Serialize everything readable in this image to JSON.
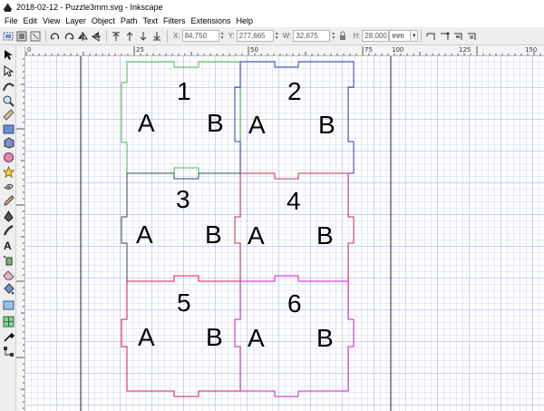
{
  "window": {
    "title": "2018-02-12 - Puzzle3mm.svg - Inkscape"
  },
  "menu": [
    {
      "label": "File",
      "icon": ""
    },
    {
      "label": "Edit",
      "icon": ""
    },
    {
      "label": "View",
      "icon": ""
    },
    {
      "label": "Layer",
      "icon": ""
    },
    {
      "label": "Object",
      "icon": ""
    },
    {
      "label": "Path",
      "icon": ""
    },
    {
      "label": "Text",
      "icon": ""
    },
    {
      "label": "Filters",
      "icon": ""
    },
    {
      "label": "Extensions",
      "icon": ""
    },
    {
      "label": "Help",
      "icon": ""
    }
  ],
  "toolbar": {
    "x_label": "X:",
    "x_value": "84,750",
    "y_label": "Y:",
    "y_value": "277,665",
    "w_label": "W:",
    "w_value": "32,675",
    "h_label": "H:",
    "h_value": "28,000",
    "unit": "mm"
  },
  "ruler": {
    "h_labels": [
      "0",
      "25",
      "50",
      "75",
      "100",
      "125",
      "150"
    ],
    "v_labels": [
      "100",
      "75",
      "50",
      "25",
      "0"
    ]
  },
  "pieces": [
    {
      "number": "1",
      "left_letter": "A",
      "right_letter": "B",
      "color": "#4ab84a"
    },
    {
      "number": "2",
      "left_letter": "A",
      "right_letter": "B",
      "color": "#3a3ab0"
    },
    {
      "number": "3",
      "left_letter": "A",
      "right_letter": "B",
      "color": "#2f4a4a"
    },
    {
      "number": "4",
      "left_letter": "A",
      "right_letter": "B",
      "color": "#c0304a"
    },
    {
      "number": "5",
      "left_letter": "A",
      "right_letter": "B",
      "color": "#d01a4a"
    },
    {
      "number": "6",
      "left_letter": "A",
      "right_letter": "B",
      "color": "#c81ac8"
    }
  ],
  "colors": {
    "grid_minor": "#cdd2f0",
    "grid_major": "#8f9ae6",
    "page_border": "#202020"
  }
}
